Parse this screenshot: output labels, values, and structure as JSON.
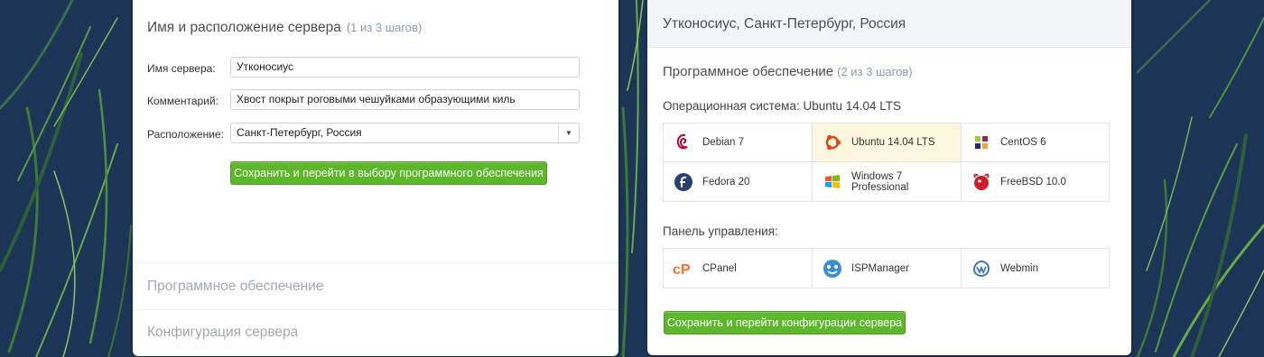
{
  "server_form": {
    "title": "Имя и расположение сервера",
    "step": "(1 из 3 шагов)",
    "name_label": "Имя сервера:",
    "name_value": "Утконосиус",
    "comment_label": "Комментарий:",
    "comment_value": "Хвост покрыт роговыми чешуйками образующими киль",
    "location_label": "Расположение:",
    "location_value": "Санкт-Петербург, Россия",
    "save_button": "Сохранить и перейти в выбору программного обеспечения",
    "section_software": "Программное обеспечение",
    "section_config": "Конфигурация сервера"
  },
  "software_form": {
    "server_summary": "Утконосиус, Санкт-Петербург, Россия",
    "title": "Программное обеспечение",
    "step": "(2 из 3 шагов)",
    "os_label": "Операционная система: Ubuntu 14.04 LTS",
    "os_options": [
      {
        "label": "Debian 7",
        "icon": "debian-icon",
        "selected": false
      },
      {
        "label": "Ubuntu 14.04 LTS",
        "icon": "ubuntu-icon",
        "selected": true
      },
      {
        "label": "CentOS 6",
        "icon": "centos-icon",
        "selected": false
      },
      {
        "label": "Fedora 20",
        "icon": "fedora-icon",
        "selected": false
      },
      {
        "label": "Windows 7 Professional",
        "icon": "windows-icon",
        "selected": false
      },
      {
        "label": "FreeBSD 10.0",
        "icon": "freebsd-icon",
        "selected": false
      }
    ],
    "panel_label": "Панель управления:",
    "panel_options": [
      {
        "label": "CPanel",
        "icon": "cpanel-icon"
      },
      {
        "label": "ISPManager",
        "icon": "ispmanager-icon"
      },
      {
        "label": "Webmin",
        "icon": "webmin-icon"
      }
    ],
    "save_button": "Сохранить и перейти конфигурации сервера"
  },
  "colors": {
    "background": "#1b3355",
    "button_green": "#5cb82a",
    "selected_cell": "#fdf7e0"
  }
}
